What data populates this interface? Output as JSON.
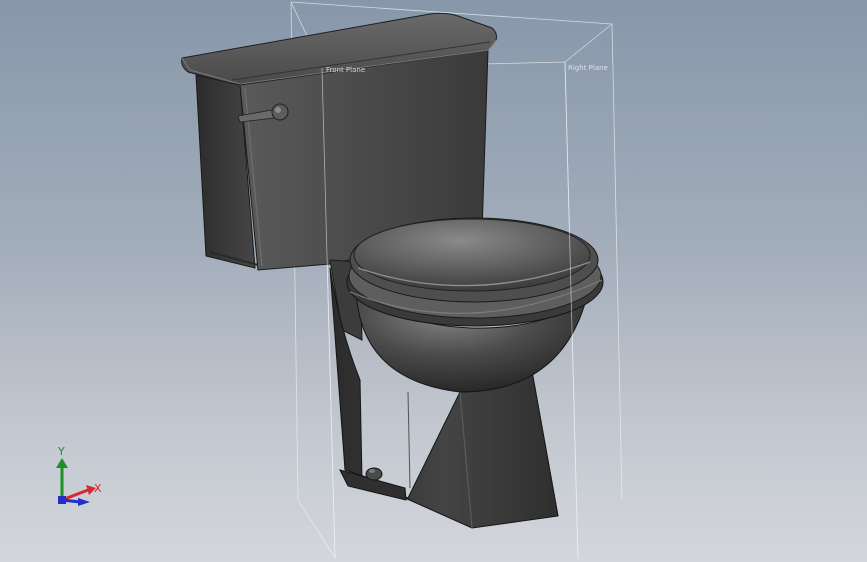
{
  "viewport": {
    "background_top": "#8797aa",
    "background_bottom": "#d3d6dc",
    "model_color": "#3f3f3f"
  },
  "planes": {
    "front_label": "Front Plane",
    "right_label": "Right Plane"
  },
  "triad": {
    "x_label": "X",
    "y_label": "Y",
    "x_color": "#d8282d",
    "y_color": "#1f8f2a",
    "z_color": "#2230c8"
  }
}
